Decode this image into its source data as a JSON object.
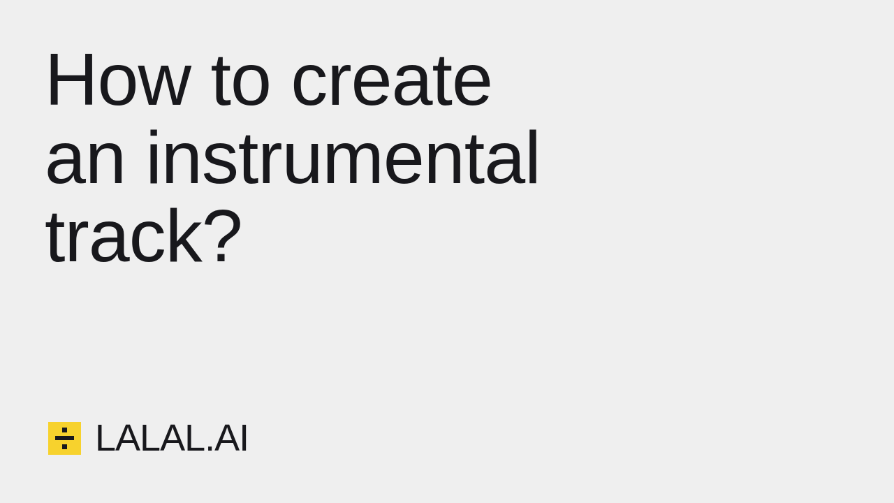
{
  "headline": {
    "lines": [
      "How to create",
      "an instrumental",
      "track?"
    ]
  },
  "brand": {
    "name": "LALAL.AI",
    "logo_icon": "divide-icon",
    "logo_color": "#f7d22d"
  },
  "colors": {
    "background": "#efefef",
    "text": "#18181c"
  }
}
